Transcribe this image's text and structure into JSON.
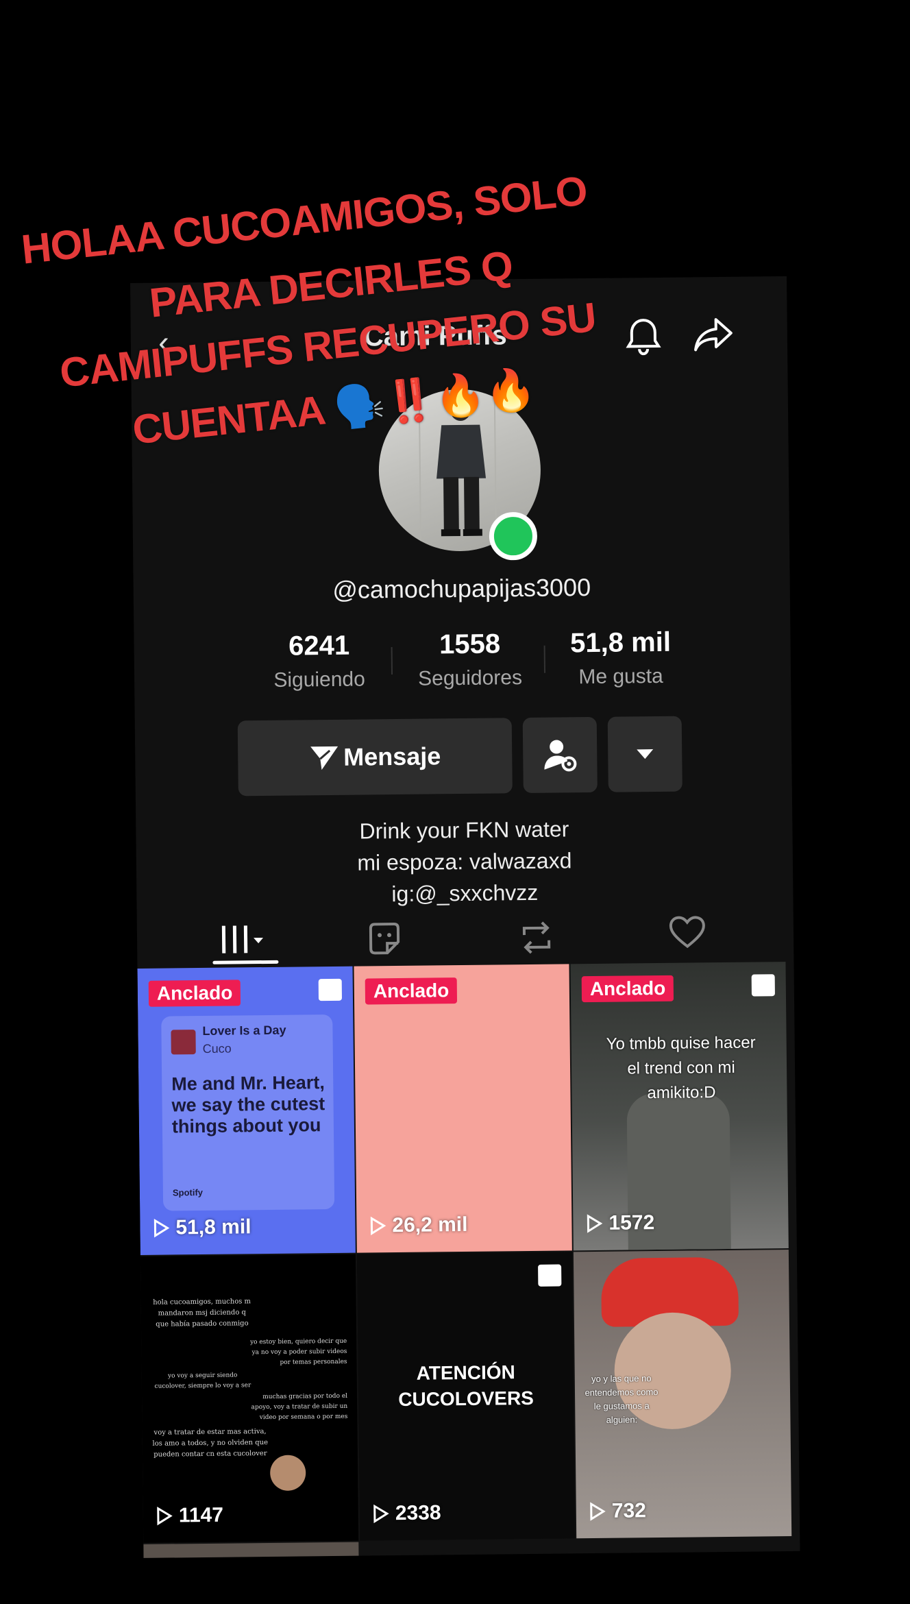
{
  "profile": {
    "title": "Cami Puffs",
    "handle": "@camochupapijas3000",
    "stats": [
      {
        "value": "6241",
        "label": "Siguiendo"
      },
      {
        "value": "1558",
        "label": "Seguidores"
      },
      {
        "value": "51,8 mil",
        "label": "Me gusta"
      }
    ],
    "message_label": "Mensaje",
    "bio": [
      "Drink your FKN water",
      "mi espoza: valwazaxd",
      "ig:@_sxxchvzz"
    ]
  },
  "tabs": {
    "icons": [
      "grid-icon",
      "sticker-icon",
      "repost-icon",
      "heart-icon"
    ]
  },
  "videos": [
    {
      "pinned": "Anclado",
      "views": "51,8 mil",
      "photo": true,
      "song": "Lover Is a Day",
      "artist": "Cuco",
      "quote": "Me and Mr. Heart, we say the cutest things about you",
      "brand": "Spotify",
      "bg": "#5a6ff0"
    },
    {
      "pinned": "Anclado",
      "views": "26,2 mil",
      "photo": false,
      "bg": "#f6a39b"
    },
    {
      "pinned": "Anclado",
      "views": "1572",
      "photo": true,
      "caption": "Yo tmbb quise hacer el trend con mi amikito:D",
      "bg": "#3b3f3c"
    },
    {
      "pinned": "",
      "views": "1147",
      "photo": false,
      "lines": [
        "hola cucoamigos, muchos m mandaron msj diciendo q que había pasado conmigo",
        "yo estoy bien, quiero decir que ya no voy a poder subir videos por temas personales",
        "yo voy a seguir siendo cucolover, siempre lo voy a ser",
        "muchas gracias por todo el apoyo, voy a tratar de subir un video por semana o por mes",
        "voy a tratar de estar mas activa, los amo a todos, y no olviden que pueden contar cn esta cucolover"
      ],
      "bg": "#000000"
    },
    {
      "pinned": "",
      "views": "2338",
      "photo": true,
      "caption": "ATENCIÓN CUCOLOVERS",
      "bg": "#0a0a0a"
    },
    {
      "pinned": "",
      "views": "732",
      "photo": false,
      "caption": "yo y las que no entendemos como le gustamos a alguien:",
      "bg": "#7a7470"
    }
  ],
  "overlay_text": [
    "HOLAA CUCOAMIGOS, SOLO",
    "PARA DECIRLES Q",
    "CAMIPUFFS RECUPERO SU",
    "CUENTAA 🗣️‼️🔥🔥"
  ],
  "colors": {
    "accent": "#ee1d52",
    "overlay": "#e43a3a",
    "online": "#20c55a"
  }
}
